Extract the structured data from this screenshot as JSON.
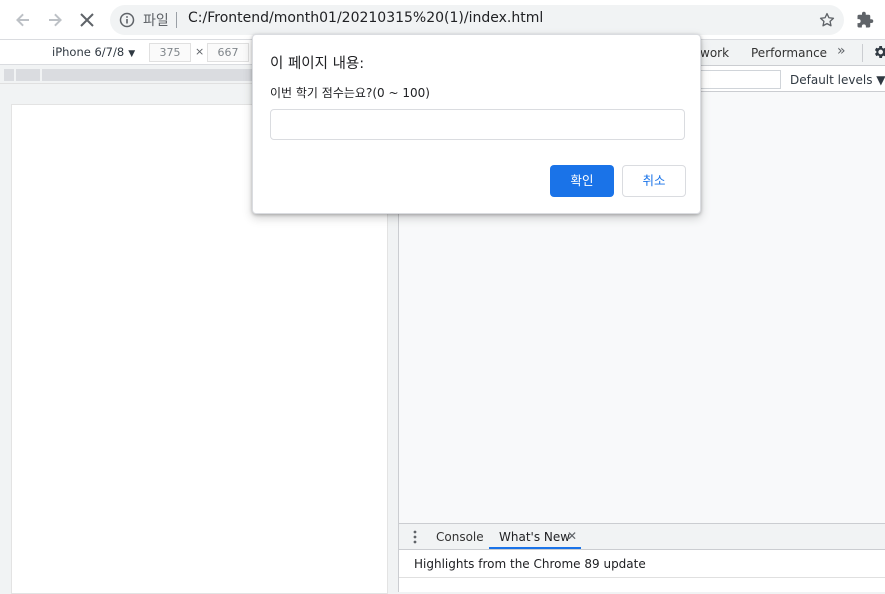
{
  "browser": {
    "omnibox": {
      "chip_label": "파일",
      "url": "C:/Frontend/month01/20210315%20(1)/index.html"
    }
  },
  "device_toolbar": {
    "device": "iPhone 6/7/8",
    "width": "375",
    "height": "667",
    "times": "×"
  },
  "devtools": {
    "tabs": [
      {
        "label": "work"
      },
      {
        "label": "Performance"
      }
    ],
    "more": "»",
    "levels_label": "Default levels ▼",
    "drawer": {
      "tabs": [
        {
          "label": "Console"
        },
        {
          "label": "What's New"
        }
      ],
      "close_glyph": "✕",
      "highlights": "Highlights from the Chrome 89 update"
    }
  },
  "dialog": {
    "title": "이 페이지 내용:",
    "message": "이번 학기 점수는요?(0 ~ 100)",
    "input_value": "",
    "ok_label": "확인",
    "cancel_label": "취소"
  },
  "colors": {
    "accent": "#1a73e8",
    "toolbar_bg": "#ffffff",
    "devtools_bg": "#f1f3f4"
  }
}
